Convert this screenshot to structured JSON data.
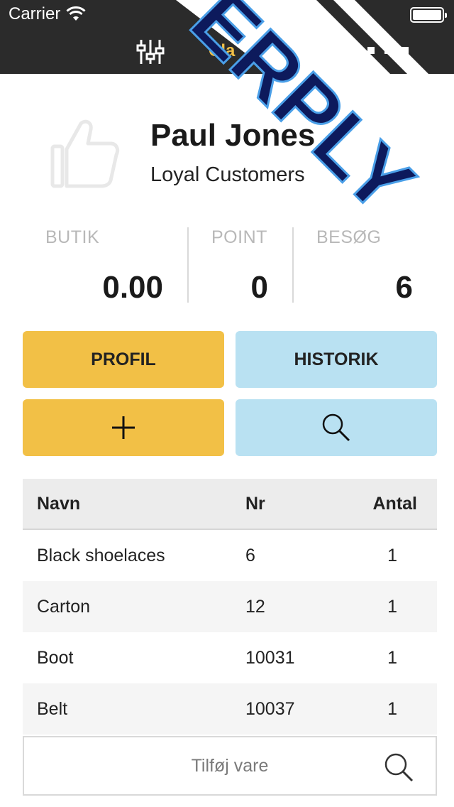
{
  "status_bar": {
    "carrier": "Carrier"
  },
  "nav": {
    "active_label": "Cla"
  },
  "brand": {
    "text": "ERPLY",
    "colors": {
      "dark": "#0d1a5c",
      "light": "#4a9fe8"
    }
  },
  "customer": {
    "name": "Paul Jones",
    "group": "Loyal Customers"
  },
  "stats": [
    {
      "label": "BUTIK",
      "value": "0.00"
    },
    {
      "label": "POINT",
      "value": "0"
    },
    {
      "label": "BESØG",
      "value": "6"
    }
  ],
  "buttons": {
    "profile": "PROFIL",
    "history": "HISTORIK"
  },
  "table": {
    "headers": {
      "name": "Navn",
      "nr": "Nr",
      "qty": "Antal"
    },
    "rows": [
      {
        "name": "Black shoelaces",
        "nr": "6",
        "qty": "1"
      },
      {
        "name": "Carton",
        "nr": "12",
        "qty": "1"
      },
      {
        "name": "Boot",
        "nr": "10031",
        "qty": "1"
      },
      {
        "name": "Belt",
        "nr": "10037",
        "qty": "1"
      }
    ]
  },
  "add_item": {
    "placeholder": "Tilføj vare"
  },
  "colors": {
    "accent_yellow": "#f2c046",
    "accent_blue": "#b9e1f2",
    "topbar": "#2b2b2b"
  },
  "icons": [
    "wifi-icon",
    "battery-icon",
    "filter-sliders-icon",
    "more-icon",
    "thumbs-up-icon",
    "plus-icon",
    "search-icon"
  ]
}
